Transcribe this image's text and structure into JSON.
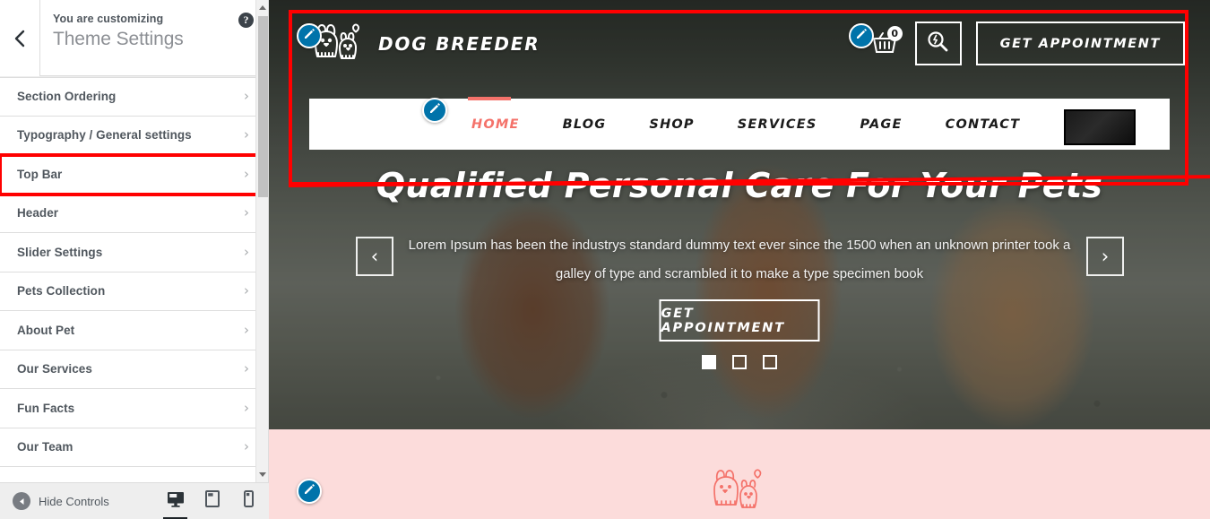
{
  "customizer": {
    "back_icon": "chevron-left-icon",
    "customizing_label": "You are customizing",
    "theme_title": "Theme Settings",
    "help_icon": "?",
    "sections": [
      {
        "label": "Section Ordering",
        "highlighted": false
      },
      {
        "label": "Typography / General settings",
        "highlighted": false
      },
      {
        "label": "Top Bar",
        "highlighted": true
      },
      {
        "label": "Header",
        "highlighted": false
      },
      {
        "label": "Slider Settings",
        "highlighted": false
      },
      {
        "label": "Pets Collection",
        "highlighted": false
      },
      {
        "label": "About Pet",
        "highlighted": false
      },
      {
        "label": "Our Services",
        "highlighted": false
      },
      {
        "label": "Fun Facts",
        "highlighted": false
      },
      {
        "label": "Our Team",
        "highlighted": false
      }
    ],
    "chevron": "›",
    "footer": {
      "hide_controls_label": "Hide Controls",
      "hide_controls_icon": "collapse-left-icon",
      "devices": [
        {
          "name": "desktop",
          "active": true
        },
        {
          "name": "tablet",
          "active": false
        },
        {
          "name": "mobile",
          "active": false
        }
      ]
    },
    "scrollbar": {
      "up_arrow": "scroll-up-arrow",
      "down_arrow": "scroll-down-arrow"
    }
  },
  "preview": {
    "brand": {
      "name": "DOG BREEDER",
      "logo_icon": "dog-cat-logo-icon"
    },
    "header_actions": {
      "cart_icon": "shopping-basket-icon",
      "cart_count": "0",
      "search_icon": "search-icon",
      "appointment_label": "GET APPOINTMENT"
    },
    "nav": {
      "items": [
        {
          "label": "HOME",
          "active": true
        },
        {
          "label": "BLOG",
          "active": false
        },
        {
          "label": "SHOP",
          "active": false
        },
        {
          "label": "SERVICES",
          "active": false
        },
        {
          "label": "PAGE",
          "active": false
        },
        {
          "label": "CONTACT",
          "active": false
        }
      ],
      "thumbnail": "nav-thumbnail-image"
    },
    "hero": {
      "title": "Qualified Personal Care For Your Pets",
      "subtitle": "Lorem Ipsum has been the industrys standard dummy text ever since the 1500 when an unknown printer took a galley of type and scrambled it to make a type specimen book",
      "cta_label": "GET APPOINTMENT",
      "prev_icon": "‹",
      "next_icon": "›",
      "dots": [
        {
          "active": true
        },
        {
          "active": false
        },
        {
          "active": false
        }
      ]
    },
    "pink_section": {
      "logo_icon": "dog-cat-outline-icon"
    },
    "edit_shortcuts": [
      {
        "name": "edit-logo-shortcut"
      },
      {
        "name": "edit-header-actions-shortcut"
      },
      {
        "name": "edit-menu-shortcut"
      },
      {
        "name": "edit-pink-section-shortcut"
      }
    ]
  },
  "annotations": {
    "highlight_color": "#ff0000",
    "boxes": [
      {
        "name": "top-bar-region-highlight"
      }
    ],
    "strikes": [
      {
        "name": "hero-title-strikethrough"
      }
    ]
  },
  "colors": {
    "accent": "#f4726a",
    "wp_blue": "#0073aa",
    "pink_bg": "#fcdcdb",
    "sidebar_bg": "#eeeeee",
    "text": "#50575e"
  }
}
